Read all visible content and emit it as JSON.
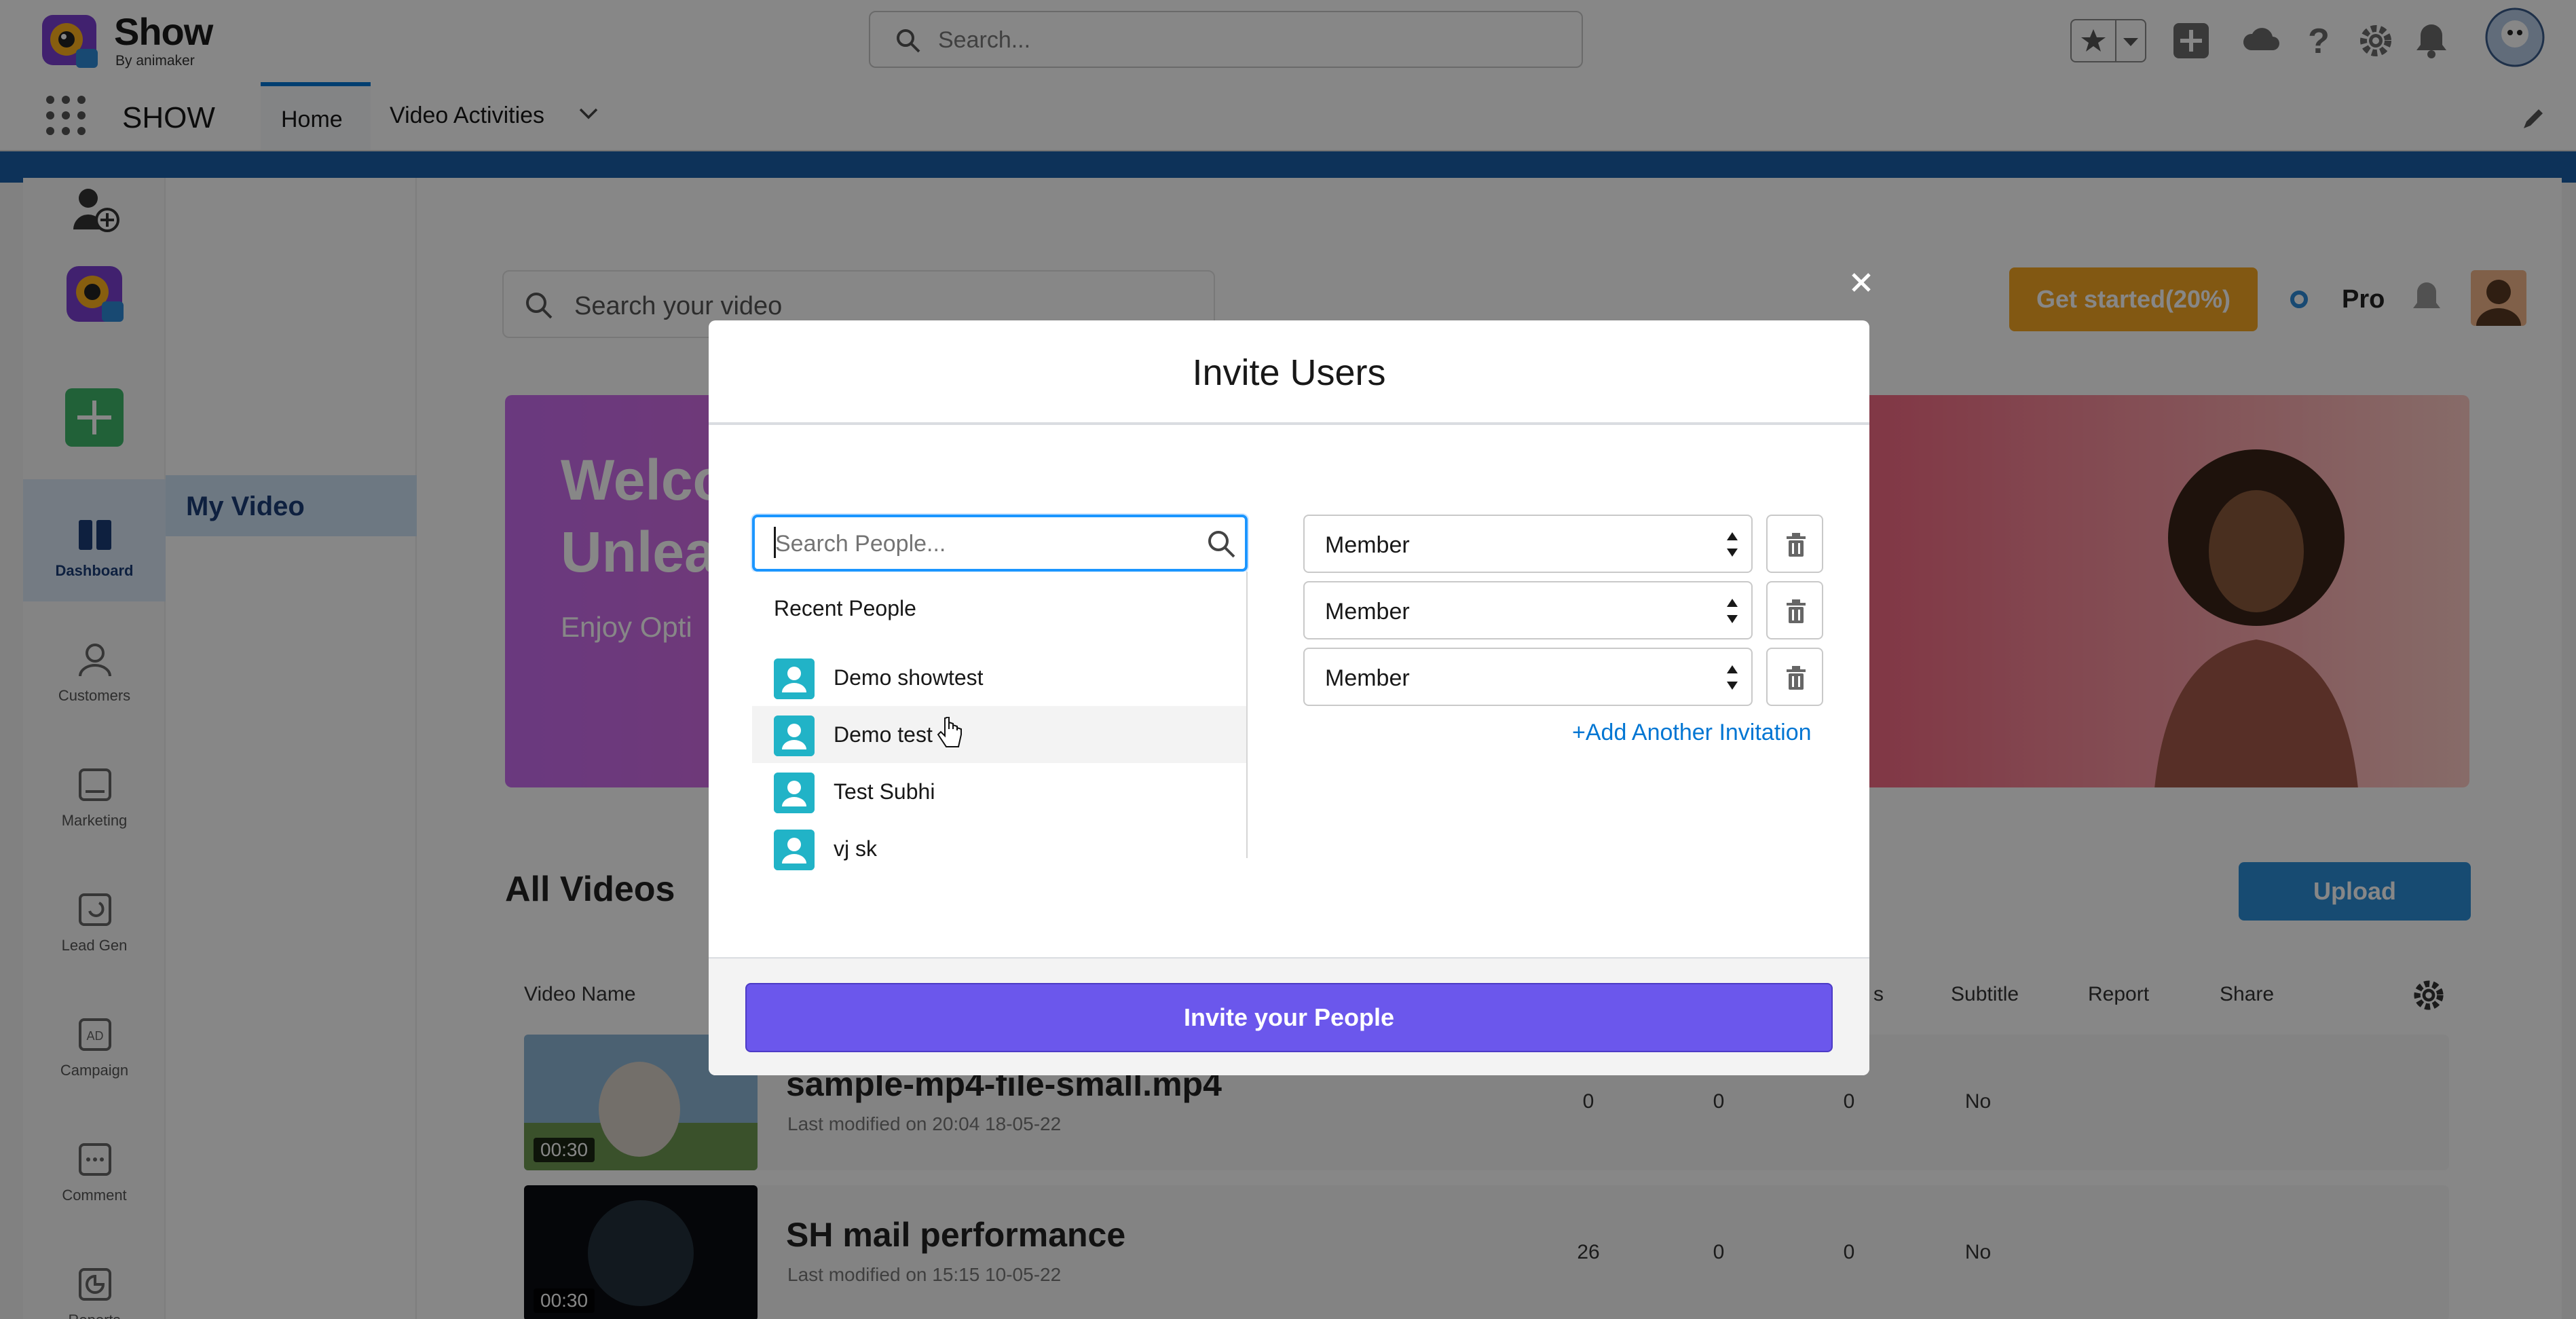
{
  "header": {
    "brand": "Show",
    "brand_sub": "By animaker",
    "search_placeholder": "Search..."
  },
  "nav": {
    "app_name": "SHOW",
    "tabs": [
      {
        "label": "Home",
        "active": true
      },
      {
        "label": "Video Activities",
        "active": false
      }
    ]
  },
  "rail": {
    "items": [
      {
        "label": "Dashboard",
        "icon": "dashboard-icon",
        "active": true
      },
      {
        "label": "Customers",
        "icon": "customers-icon"
      },
      {
        "label": "Marketing",
        "icon": "marketing-icon"
      },
      {
        "label": "Lead Gen",
        "icon": "lead-gen-icon"
      },
      {
        "label": "Campaign",
        "icon": "campaign-icon"
      },
      {
        "label": "Comment",
        "icon": "comment-icon"
      },
      {
        "label": "Reports",
        "icon": "reports-icon"
      }
    ],
    "campaign_glyph": "AD"
  },
  "sub_panel": {
    "my_video": "My Video"
  },
  "main": {
    "search_placeholder": "Search your video",
    "get_started": "Get started(20%)",
    "plan": "Pro",
    "banner_title_1": "Welco",
    "banner_title_2": "Unleas",
    "banner_sub": "Enjoy Opti",
    "all_videos": "All Videos",
    "upload": "Upload",
    "columns": {
      "video_name": "Video Name",
      "partial": "s",
      "subtitle": "Subtitle",
      "report": "Report",
      "share": "Share"
    },
    "videos": [
      {
        "title": "sample-mp4-file-small.mp4",
        "modified": "Last modified on 20:04 18-05-22",
        "duration": "00:30",
        "c1": "0",
        "c2": "0",
        "c3": "0",
        "subtitle": "No"
      },
      {
        "title": "SH mail performance",
        "modified": "Last modified on 15:15 10-05-22",
        "duration": "00:30",
        "c1": "26",
        "c2": "0",
        "c3": "0",
        "subtitle": "No"
      }
    ]
  },
  "modal": {
    "title": "Invite Users",
    "search_placeholder": "Search People...",
    "recent_heading": "Recent People",
    "people": [
      "Demo showtest",
      "Demo test",
      "Test Subhi",
      "vj sk"
    ],
    "hovered_index": 1,
    "roles": [
      "Member",
      "Member",
      "Member"
    ],
    "add_another": "+Add Another Invitation",
    "submit": "Invite your People"
  },
  "colors": {
    "accent": "#0176d3",
    "invite_button": "#6b57ec",
    "get_started": "#f5a623",
    "upload": "#2c8fd8",
    "avatar": "#21b3c7"
  }
}
